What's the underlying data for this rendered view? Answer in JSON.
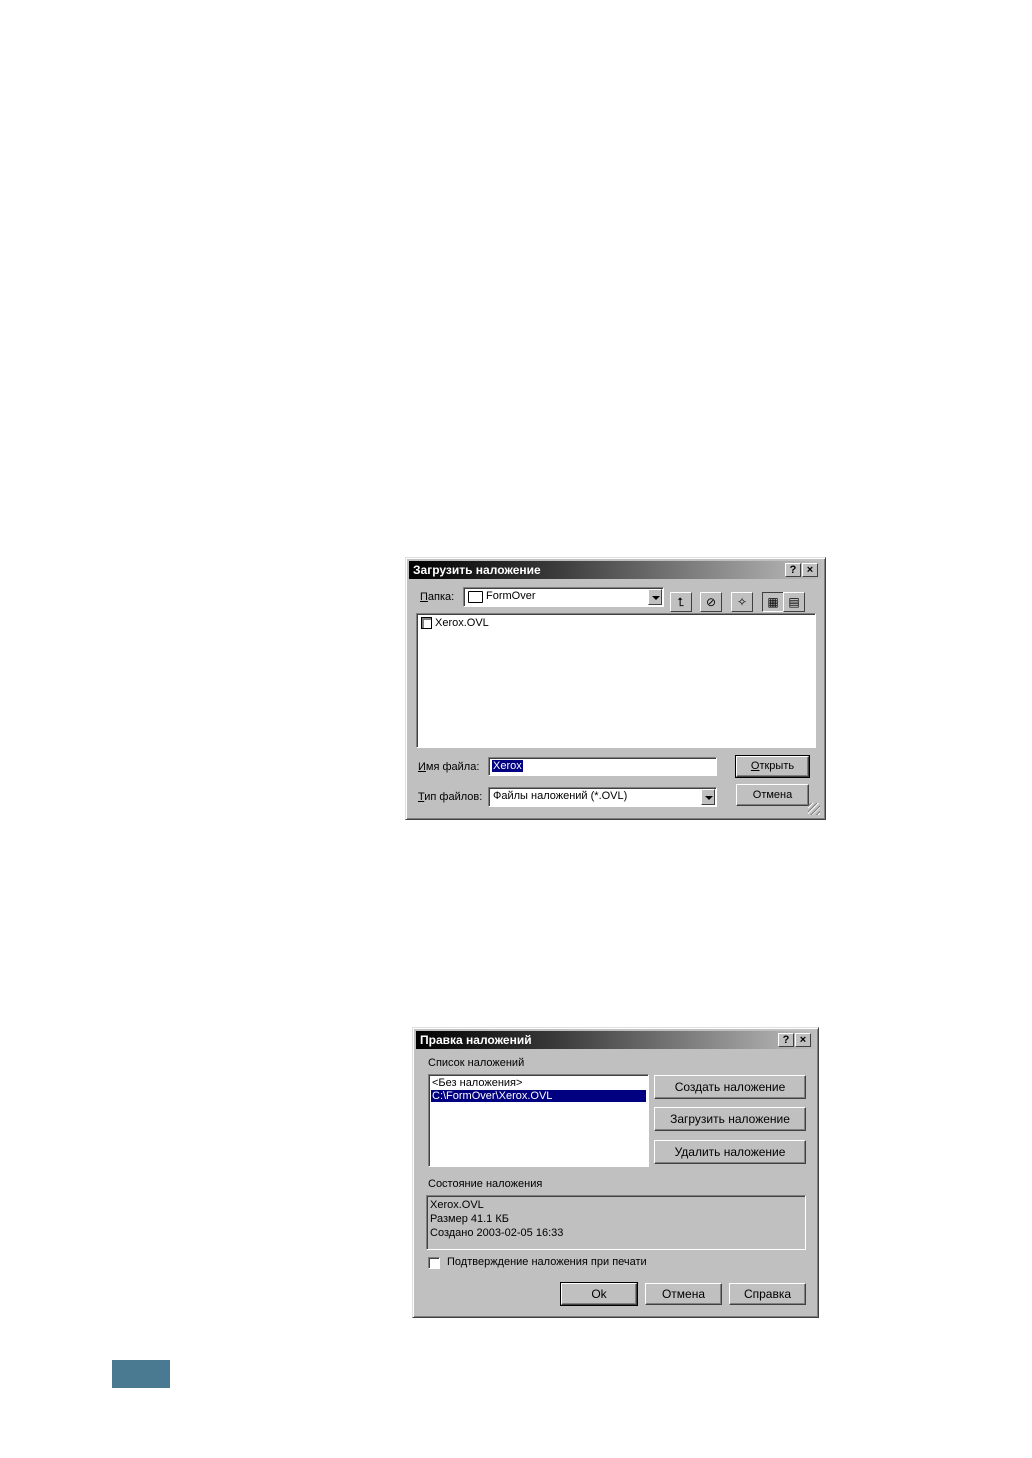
{
  "load_dialog": {
    "title": "Загрузить наложение",
    "help_btn": "?",
    "close_btn": "×",
    "folder_label_u": "П",
    "folder_label_rest": "апка:",
    "folder_value": "FormOver",
    "files": [
      {
        "name": "Xerox.OVL"
      }
    ],
    "filename_label_u": "И",
    "filename_label_rest": "мя файла:",
    "filename_value": "Xerox",
    "filetype_label_u": "Т",
    "filetype_label_rest": "ип файлов:",
    "filetype_value": "Файлы наложений (*.OVL)",
    "open_btn_u": "О",
    "open_btn_rest": "ткрыть",
    "cancel_btn": "Отмена"
  },
  "edit_dialog": {
    "title": "Правка наложений",
    "help_btn": "?",
    "close_btn": "×",
    "list_label": "Список наложений",
    "list_items": [
      "<Без наложения>",
      "C:\\FormOver\\Xerox.OVL"
    ],
    "create_btn": "Создать наложение",
    "load_btn": "Загрузить наложение",
    "delete_btn": "Удалить наложение",
    "status_label": "Состояние наложения",
    "status_lines": [
      "Xerox.OVL",
      "Размер 41.1 КБ",
      "Создано 2003-02-05 16:33"
    ],
    "confirm_label": "Подтверждение наложения при печати",
    "ok_btn": "Ok",
    "cancel_btn": "Отмена",
    "help_text_btn": "Справка"
  }
}
